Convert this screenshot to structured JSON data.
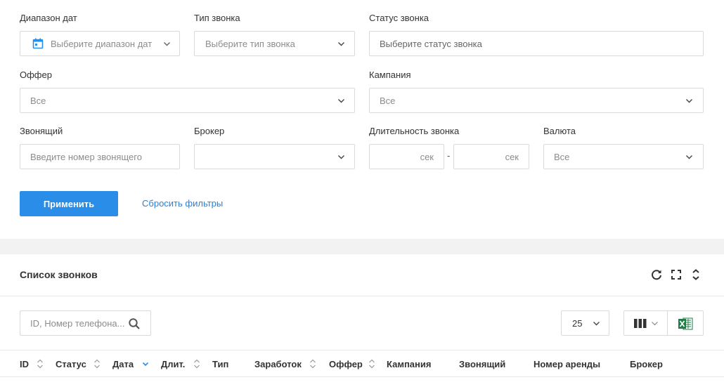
{
  "filters": {
    "date_range": {
      "label": "Диапазон дат",
      "placeholder": "Выберите диапазон дат",
      "icon": "calendar-icon"
    },
    "call_type": {
      "label": "Тип звонка",
      "placeholder": "Выберите тип звонка"
    },
    "call_status": {
      "label": "Статус звонка",
      "placeholder": "Выберите статус звонка"
    },
    "offer": {
      "label": "Оффер",
      "value": "Все"
    },
    "campaign": {
      "label": "Кампания",
      "value": "Все"
    },
    "caller": {
      "label": "Звонящий",
      "placeholder": "Введите номер звонящего"
    },
    "broker": {
      "label": "Брокер",
      "value": ""
    },
    "duration": {
      "label": "Длительность звонка",
      "from_unit": "сек",
      "separator": "-",
      "to_unit": "сек"
    },
    "currency": {
      "label": "Валюта",
      "value": "Все"
    },
    "apply_label": "Применить",
    "reset_label": "Сбросить фильтры"
  },
  "calls_list": {
    "title": "Список звонков",
    "header_icons": [
      "refresh-icon",
      "fullscreen-icon",
      "collapse-icon"
    ],
    "search_placeholder": "ID, Номер телефона...",
    "page_size": "25",
    "columns_icon": "columns-icon",
    "export_icon": "excel-icon",
    "columns": [
      {
        "label": "ID",
        "sortable": true
      },
      {
        "label": "Статус",
        "sortable": true
      },
      {
        "label": "Дата",
        "sortable": true,
        "sorted": "desc"
      },
      {
        "label": "Длит.",
        "sortable": true
      },
      {
        "label": "Тип",
        "sortable": false
      },
      {
        "label": "Заработок",
        "sortable": true
      },
      {
        "label": "Оффер",
        "sortable": true
      },
      {
        "label": "Кампания",
        "sortable": false
      },
      {
        "label": "Звонящий",
        "sortable": false
      },
      {
        "label": "Номер аренды",
        "sortable": false
      },
      {
        "label": "Брокер",
        "sortable": false
      }
    ]
  },
  "colors": {
    "accent": "#2a8de8",
    "link": "#2a7fd6",
    "excel_green": "#1e7e45",
    "sort_active": "#2a8de8"
  }
}
